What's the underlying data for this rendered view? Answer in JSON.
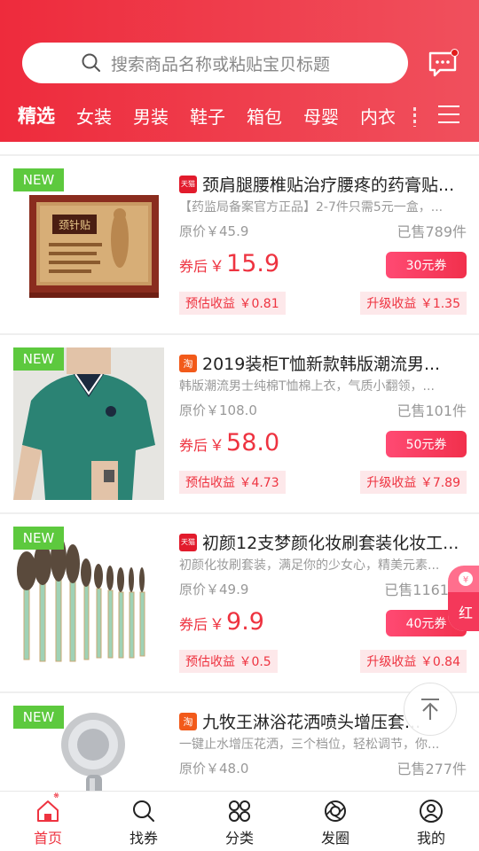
{
  "header": {
    "search_placeholder": "搜索商品名称或粘贴宝贝标题",
    "tabs": [
      "精选",
      "女装",
      "男装",
      "鞋子",
      "箱包",
      "母婴",
      "内衣"
    ]
  },
  "colors": {
    "brand_red": "#ee2b3c",
    "new_green": "#5dc93e",
    "price_red": "#ee3340"
  },
  "products": [
    {
      "tag": "NEW",
      "shop": "天猫",
      "title": "颈肩腿腰椎贴治疗腰疼的药膏贴...",
      "desc": "【药监局备案官方正品】2-7件只需5元一盒，...",
      "orig_price": "原价￥45.9",
      "sold": "已售789件",
      "after_label": "券后",
      "yen": "￥",
      "price": "15.9",
      "coupon": "30元券",
      "est_earn": "预估收益 ￥0.81",
      "up_earn": "升级收益 ￥1.35"
    },
    {
      "tag": "NEW",
      "shop": "淘",
      "title": "2019装柜T恤新款韩版潮流男...",
      "desc": "韩版潮流男士纯棉T恤棉上衣，气质小翻领，...",
      "orig_price": "原价￥108.0",
      "sold": "已售101件",
      "after_label": "券后",
      "yen": "￥",
      "price": "58.0",
      "coupon": "50元券",
      "est_earn": "预估收益 ￥4.73",
      "up_earn": "升级收益 ￥7.89"
    },
    {
      "tag": "NEW",
      "shop": "天猫",
      "title": "初颜12支梦颜化妆刷套装化妆工...",
      "desc": "初颜化妆刷套装，满足你的少女心，精美元素...",
      "orig_price": "原价￥49.9",
      "sold": "已售1161",
      "after_label": "券后",
      "yen": "￥",
      "price": "9.9",
      "coupon": "40元券",
      "est_earn": "预估收益 ￥0.5",
      "up_earn": "升级收益 ￥0.84"
    },
    {
      "tag": "NEW",
      "shop": "淘",
      "title": "九牧王淋浴花洒喷头增压套...",
      "desc": "一键止水增压花洒，三个档位，轻松调节，你...",
      "orig_price": "原价￥48.0",
      "sold": "已售277件"
    }
  ],
  "floating": {
    "red_packet_label": "红"
  },
  "bottom_nav": [
    {
      "label": "首页",
      "icon": "home-icon",
      "active": true
    },
    {
      "label": "找券",
      "icon": "search-icon"
    },
    {
      "label": "分类",
      "icon": "category-icon"
    },
    {
      "label": "发圈",
      "icon": "camera-icon"
    },
    {
      "label": "我的",
      "icon": "user-icon"
    }
  ]
}
